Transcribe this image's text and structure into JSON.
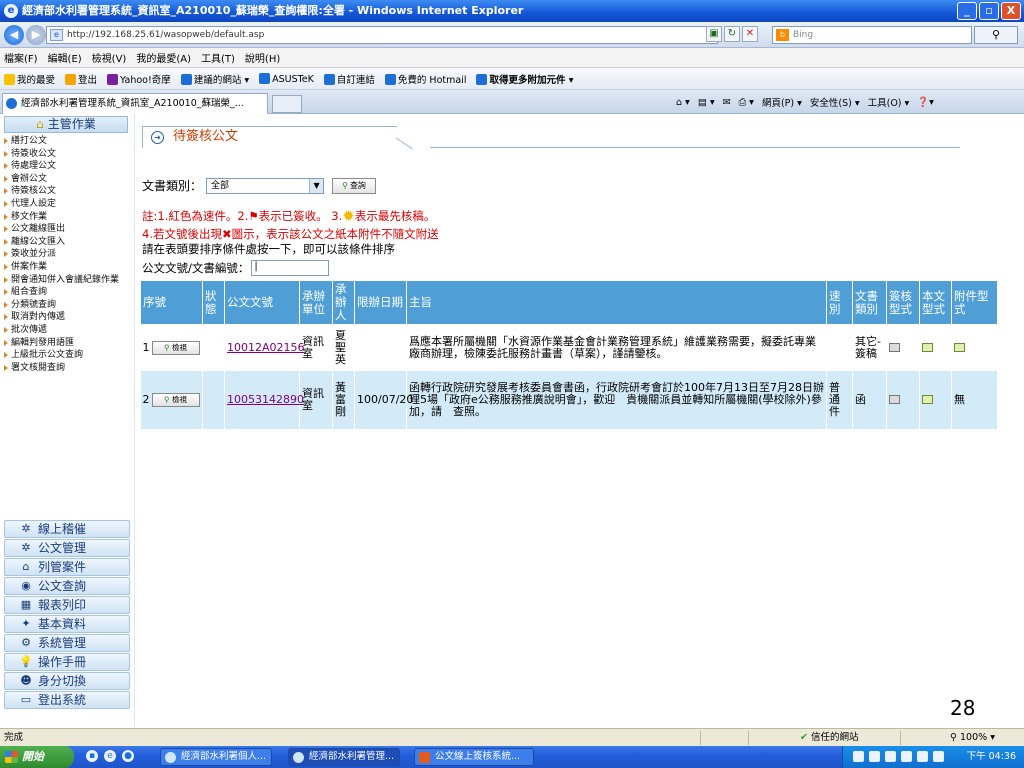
{
  "window": {
    "title": "經濟部水利署管理系統_資訊室_A210010_蘇瑞榮_查詢權限:全署 - Windows Internet Explorer",
    "buttons": [
      "_",
      "▫",
      "X"
    ]
  },
  "address": {
    "url": "http://192.168.25.61/wasopweb/default.asp",
    "search_placeholder": "Bing"
  },
  "menu": [
    "檔案(F)",
    "編輯(E)",
    "檢視(V)",
    "我的最愛(A)",
    "工具(T)",
    "說明(H)"
  ],
  "favorites": {
    "label": "我的最愛",
    "items": [
      {
        "label": "登出",
        "bold": false
      },
      {
        "label": "Yahoo!奇摩",
        "bold": false
      },
      {
        "label": "建議的網站 ▾",
        "bold": false
      },
      {
        "label": "ASUSTeK",
        "bold": false
      },
      {
        "label": "自訂連結",
        "bold": false
      },
      {
        "label": "免費的 Hotmail",
        "bold": false
      },
      {
        "label": "取得更多附加元件 ▾",
        "bold": true
      }
    ]
  },
  "tab": {
    "label": "經濟部水利署管理系統_資訊室_A210010_蘇瑞榮_..."
  },
  "commands": [
    "網頁(P) ▾",
    "安全性(S) ▾",
    "工具(O) ▾"
  ],
  "sidebar": {
    "header": "主管作業",
    "items": [
      "繕打公文",
      "待簽收公文",
      "待處理公文",
      "會辦公文",
      "待簽核公文",
      "代理人設定",
      "移文作業",
      "公文離線匯出",
      "離線公文匯入",
      "簽收並分派",
      "併案作業",
      "開會通知併入會議紀錄作業",
      "組合查詢",
      "分類號查詢",
      "取消對內傳遞",
      "批次傳遞",
      "編輯判發用語匯",
      "上級批示公文查詢",
      "署文核閱查詢"
    ],
    "bottom_nav": [
      {
        "label": "線上稽催",
        "icon": "gear-icon",
        "glyph": "✲"
      },
      {
        "label": "公文管理",
        "icon": "gear-icon",
        "glyph": "✲"
      },
      {
        "label": "列管案件",
        "icon": "home-icon",
        "glyph": "⌂"
      },
      {
        "label": "公文查詢",
        "icon": "globe-icon",
        "glyph": "◉"
      },
      {
        "label": "報表列印",
        "icon": "chart-icon",
        "glyph": "▦"
      },
      {
        "label": "基本資料",
        "icon": "wrench-icon",
        "glyph": "✦"
      },
      {
        "label": "系統管理",
        "icon": "settings-icon",
        "glyph": "⚙"
      },
      {
        "label": "操作手冊",
        "icon": "bulb-icon",
        "glyph": "💡"
      },
      {
        "label": "身分切換",
        "icon": "user-switch-icon",
        "glyph": "☻"
      },
      {
        "label": "登出系統",
        "icon": "folder-icon",
        "glyph": "▭"
      }
    ]
  },
  "page": {
    "title": "待簽核公文",
    "filter_label": "文書類別：",
    "filter_value": "全部",
    "query_button": "查詢",
    "note1_a": "註:1.紅色為速件。2.",
    "note1_b": "表示已簽收。 3.",
    "note1_c": "表示最先核稿。",
    "note2_a": "4.若文號後出現",
    "note2_b": "圖示，表示該公文之紙本附件不隨文附送",
    "note3": "請在表頭要排序條件處按一下，即可以該條件排序",
    "search_label": "公文文號/文書編號："
  },
  "table": {
    "headers": [
      "序號",
      "狀態",
      "公文文號",
      "承辦單位",
      "承辦人",
      "限辦日期",
      "主旨",
      "速別",
      "文書類別",
      "簽核型式",
      "本文型式",
      "附件型式"
    ],
    "check_label": "檢視",
    "rows": [
      {
        "seq": "1",
        "status": "",
        "doc_no": "10012A02156",
        "unit": "資訊室",
        "handler": "夏聖英",
        "deadline": "",
        "subject": "爲應本署所屬機關「水資源作業基金會計業務管理系統」維護業務需要，擬委託專業廠商辦理，檢陳委託服務計畫書（草案），謹請鑒核。",
        "speed": "",
        "doc_type": "其它-簽稿",
        "sign": "pen-icon",
        "body": "doc-icon",
        "attach": "doc-icon",
        "attach_text": ""
      },
      {
        "seq": "2",
        "status": "",
        "doc_no": "10053142890",
        "unit": "資訊室",
        "handler": "黃富剛",
        "deadline": "100/07/20",
        "subject": "函轉行政院研究發展考核委員會書函，行政院研考會訂於100年7月13日至7月28日辦理5場「政府e公務服務推廣說明會」，歡迎　貴機關派員並轉知所屬機關(學校除外)參加，請　查照。",
        "speed": "普通件",
        "doc_type": "函",
        "sign": "pen-icon",
        "body": "doc-icon",
        "attach": "",
        "attach_text": "無"
      }
    ]
  },
  "slide_number": "28",
  "status": {
    "text": "完成",
    "zone": "信任的網站",
    "zoom": "100%"
  },
  "taskbar": {
    "start": "開始",
    "tasks": [
      "經濟部水利署個人...",
      "經濟部水利署管理...",
      "公文線上簽核系統..."
    ],
    "clock": "下午 04:36"
  }
}
